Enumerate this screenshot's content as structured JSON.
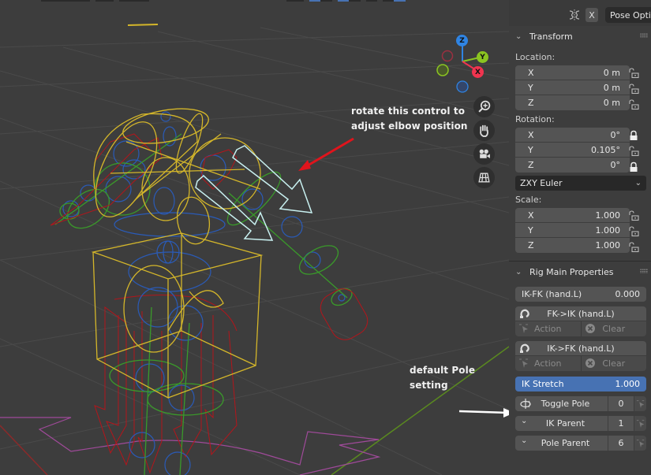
{
  "header": {
    "pose_options_label": "Pose Options",
    "xray_toggle_label": "X"
  },
  "viewport": {
    "annotations": {
      "elbow_line1": "rotate this control to",
      "elbow_line2": "adjust elbow position",
      "pole_note": "default Pole setting"
    },
    "gizmo": {
      "axes": [
        "Z",
        "Y",
        "X"
      ]
    },
    "nav_buttons": [
      "zoom-icon",
      "pan-hand-icon",
      "camera-icon",
      "perspective-grid-icon"
    ],
    "colors": {
      "background": "#3d3d3d",
      "grid": "#4a4a4a",
      "bone_yellow": "#d4b62a",
      "bone_blue": "#2a5bb8",
      "bone_green": "#3a9a2a",
      "bone_red": "#b4151b",
      "pole_arrow": "#c8f0f0",
      "annotation_arrow": "#e0141c",
      "floor_magenta": "#a04a9a",
      "axis_x": "#f0344f",
      "axis_y": "#8bc521",
      "axis_z": "#2f84e3"
    }
  },
  "sidebar": {
    "transform": {
      "title": "Transform",
      "location_label": "Location:",
      "location": [
        {
          "axis": "X",
          "value": "0 m",
          "locked": false
        },
        {
          "axis": "Y",
          "value": "0 m",
          "locked": false
        },
        {
          "axis": "Z",
          "value": "0 m",
          "locked": false
        }
      ],
      "rotation_label": "Rotation:",
      "rotation": [
        {
          "axis": "X",
          "value": "0°",
          "locked": true
        },
        {
          "axis": "Y",
          "value": "0.105°",
          "locked": false
        },
        {
          "axis": "Z",
          "value": "0°",
          "locked": true
        }
      ],
      "rotation_mode": "ZXY Euler",
      "scale_label": "Scale:",
      "scale": [
        {
          "axis": "X",
          "value": "1.000",
          "locked": false
        },
        {
          "axis": "Y",
          "value": "1.000",
          "locked": false
        },
        {
          "axis": "Z",
          "value": "1.000",
          "locked": false
        }
      ]
    },
    "rig": {
      "title": "Rig Main Properties",
      "ik_fk": {
        "label": "IK-FK (hand.L)",
        "value": "0.000"
      },
      "fk_to_ik": {
        "label": "FK->IK (hand.L)",
        "action": "Action",
        "clear": "Clear"
      },
      "ik_to_fk": {
        "label": "IK->FK (hand.L)",
        "action": "Action",
        "clear": "Clear"
      },
      "ik_stretch": {
        "label": "IK Stretch",
        "value": "1.000"
      },
      "toggle_pole": {
        "label": "Toggle Pole",
        "value": "0"
      },
      "ik_parent": {
        "label": "IK Parent",
        "value": "1"
      },
      "pole_parent": {
        "label": "Pole Parent",
        "value": "6"
      }
    }
  }
}
